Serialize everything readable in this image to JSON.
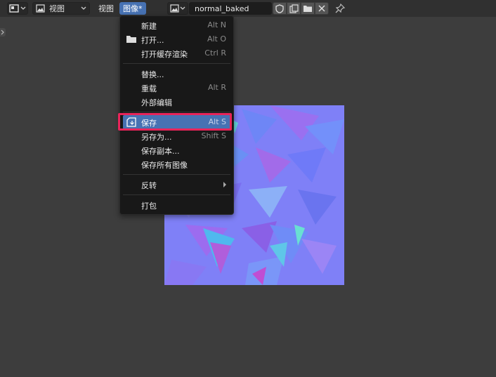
{
  "header": {
    "mode_label": "视图",
    "menus": {
      "view": "视图",
      "image": "图像*"
    },
    "image_name": "normal_baked"
  },
  "image_menu": {
    "items": [
      {
        "label": "新建",
        "shortcut": "Alt N",
        "icon": ""
      },
      {
        "label": "打开...",
        "shortcut": "Alt O",
        "icon": "folder-icon"
      },
      {
        "label": "打开缓存渲染",
        "shortcut": "Ctrl R",
        "icon": ""
      },
      {
        "label": "替换...",
        "shortcut": "",
        "icon": ""
      },
      {
        "label": "重载",
        "shortcut": "Alt R",
        "icon": ""
      },
      {
        "label": "外部编辑",
        "shortcut": "",
        "icon": ""
      },
      {
        "label": "保存",
        "shortcut": "Alt S",
        "icon": "save-icon",
        "highlighted": true
      },
      {
        "label": "另存为...",
        "shortcut": "Shift S",
        "icon": ""
      },
      {
        "label": "保存副本...",
        "shortcut": "",
        "icon": ""
      },
      {
        "label": "保存所有图像",
        "shortcut": "",
        "icon": ""
      },
      {
        "label": "反转",
        "shortcut": "",
        "icon": "",
        "submenu": true
      },
      {
        "label": "打包",
        "shortcut": "",
        "icon": ""
      }
    ]
  },
  "colors": {
    "accent": "#4772b3",
    "highlight_border": "#e8245a",
    "texture_base": "#7f80f7"
  }
}
